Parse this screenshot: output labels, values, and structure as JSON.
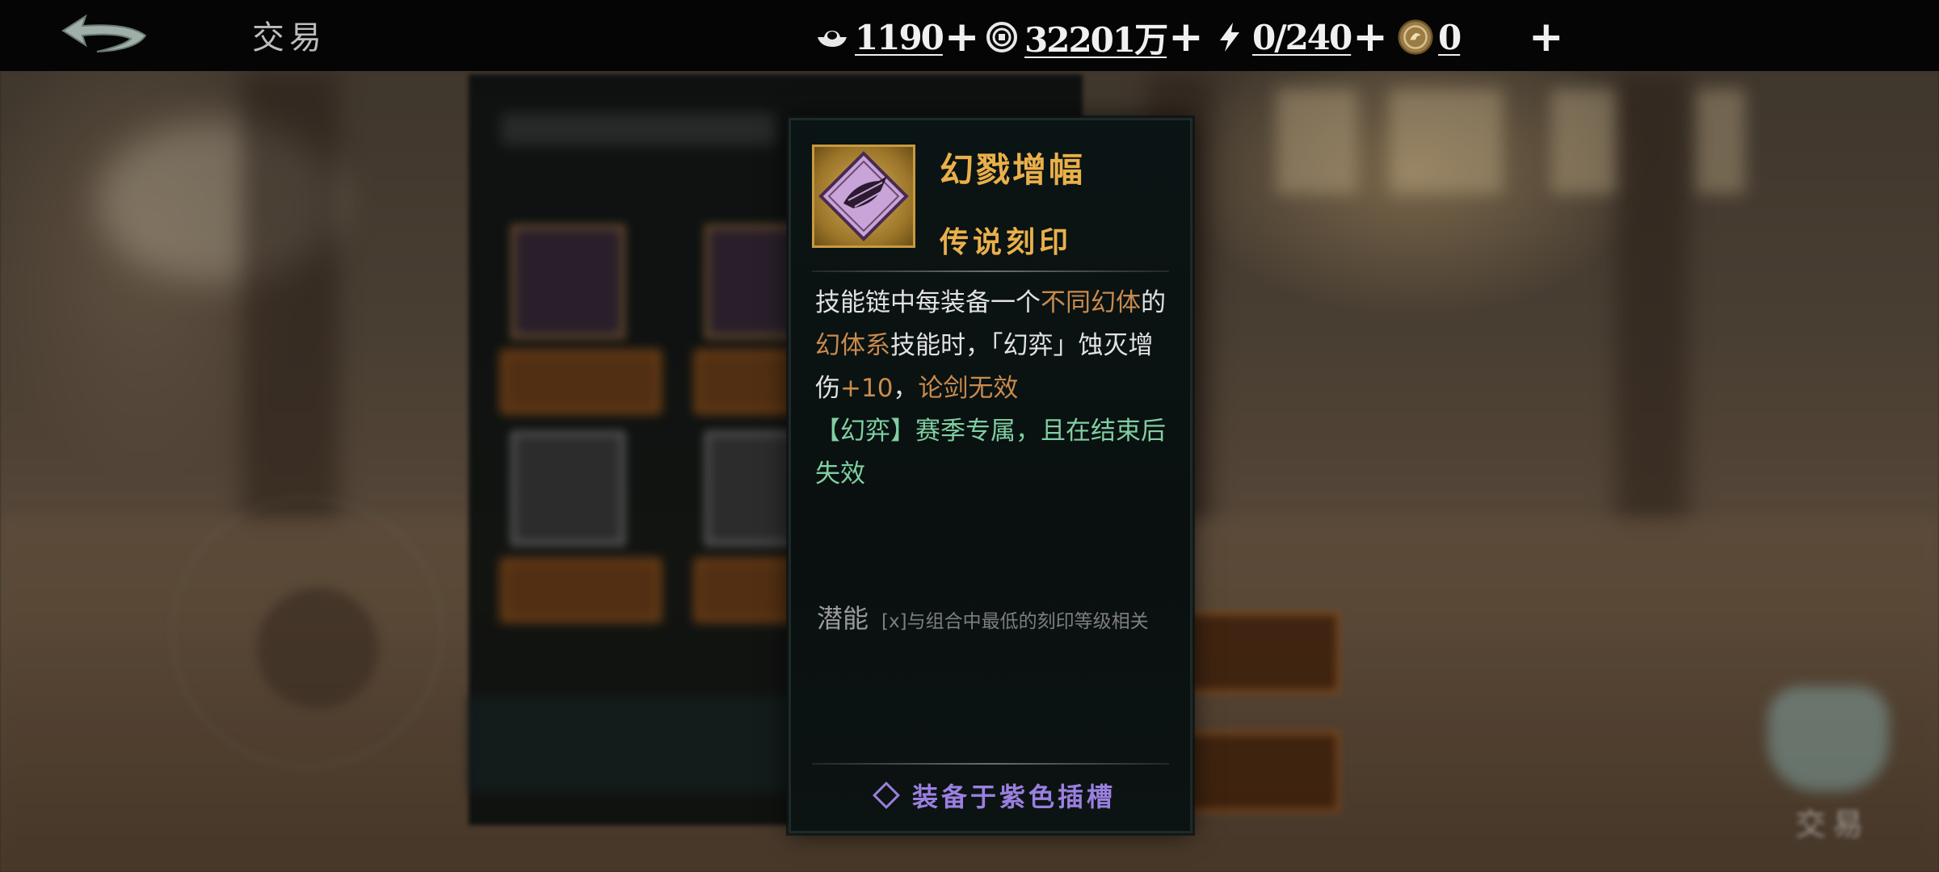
{
  "header": {
    "page_title": "交易",
    "resources": [
      {
        "icon": "silver-ingot-icon",
        "value": "1190",
        "plus": "+"
      },
      {
        "icon": "copper-coin-icon",
        "value": "32201万",
        "plus": "+"
      },
      {
        "icon": "lightning-stamina-icon",
        "value": "0/240",
        "plus": "+"
      },
      {
        "icon": "dragon-token-icon",
        "value": "0",
        "plus": "+"
      }
    ]
  },
  "tooltip": {
    "name": "幻戮增幅",
    "rarity": "传说刻印",
    "description": [
      {
        "t": "技能链中每装备一个",
        "c": "normal"
      },
      {
        "t": "不同幻体",
        "c": "hl"
      },
      {
        "t": "的",
        "c": "normal"
      },
      {
        "t": "幻体系",
        "c": "hl"
      },
      {
        "t": "技能时，「幻弈」蚀灭增伤",
        "c": "normal"
      },
      {
        "t": "+10",
        "c": "hl"
      },
      {
        "t": "，",
        "c": "normal"
      },
      {
        "t": "论剑无效",
        "c": "hl"
      }
    ],
    "season_note": "【幻弈】赛季专属，且在结束后失效",
    "potential_label": "潜能",
    "potential_text": "[x]与组合中最低的刻印等级相关",
    "equip_text": "装备于紫色插槽"
  },
  "colors": {
    "gold": "#e9b04a",
    "highlight": "#c98b4c",
    "season": "#7fcfa2",
    "purple_slot": "#9a80e0"
  }
}
